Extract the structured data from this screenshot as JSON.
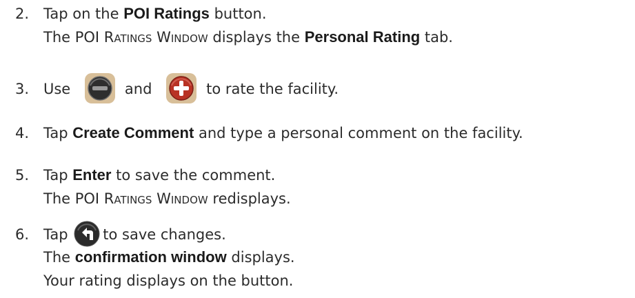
{
  "steps": [
    {
      "num": "2.",
      "l1_a": "Tap on the ",
      "l1_b": "POI Ratings",
      "l1_c": " button.",
      "l2_a": "The POI ",
      "l2_b": "Ratings Window",
      "l2_c": " displays the ",
      "l2_d": "Personal Rating",
      "l2_e": " tab."
    },
    {
      "num": "3.",
      "a": "Use",
      "b": "and",
      "c": "to rate the facility.",
      "icon1": "minus-circle-icon",
      "icon2": "plus-circle-icon"
    },
    {
      "num": "4.",
      "a": "Tap ",
      "b": "Create Comment",
      "c": " and type a personal comment on the facility."
    },
    {
      "num": "5.",
      "l1_a": "Tap ",
      "l1_b": "Enter",
      "l1_c": " to save the comment.",
      "l2_a": "The POI ",
      "l2_b": "Ratings Window",
      "l2_c": " redisplays."
    },
    {
      "num": "6.",
      "a": "Tap",
      "b": "to save changes.",
      "icon": "back-arrow-icon",
      "l2_a": "The ",
      "l2_b": "confirmation window",
      "l2_c": " displays.",
      "l3": "Your rating displays on the button."
    }
  ],
  "colors": {
    "icon_bg": "#d8bf99",
    "icon_dark": "#3a3a3a",
    "icon_red": "#c0392b",
    "text": "#2b2b2b"
  }
}
